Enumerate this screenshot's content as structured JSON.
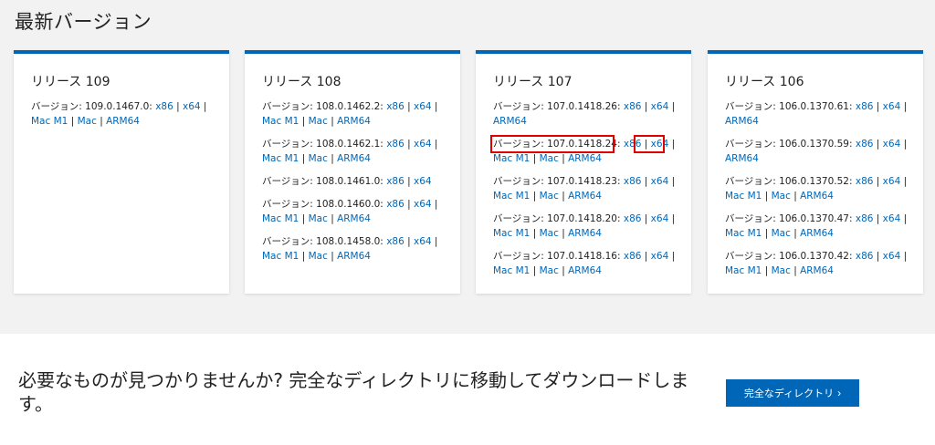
{
  "section_title": "最新バージョン",
  "cards": [
    {
      "title": "リリース 109",
      "entries": [
        {
          "label": "バージョン: 109.0.1467.0:",
          "links": [
            "x86",
            "x64",
            "Mac M1",
            "Mac",
            "ARM64"
          ]
        }
      ]
    },
    {
      "title": "リリース 108",
      "entries": [
        {
          "label": "バージョン: 108.0.1462.2:",
          "links": [
            "x86",
            "x64",
            "Mac M1",
            "Mac",
            "ARM64"
          ]
        },
        {
          "label": "バージョン: 108.0.1462.1:",
          "links": [
            "x86",
            "x64",
            "Mac M1",
            "Mac",
            "ARM64"
          ]
        },
        {
          "label": "バージョン: 108.0.1461.0:",
          "links": [
            "x86",
            "x64"
          ]
        },
        {
          "label": "バージョン: 108.0.1460.0:",
          "links": [
            "x86",
            "x64",
            "Mac M1",
            "Mac",
            "ARM64"
          ]
        },
        {
          "label": "バージョン: 108.0.1458.0:",
          "links": [
            "x86",
            "x64",
            "Mac M1",
            "Mac",
            "ARM64"
          ]
        }
      ]
    },
    {
      "title": "リリース 107",
      "entries": [
        {
          "label": "バージョン: 107.0.1418.26:",
          "links": [
            "x86",
            "x64",
            "ARM64"
          ]
        },
        {
          "label": "バージョン: 107.0.1418.24:",
          "links": [
            "x86",
            "x64",
            "Mac M1",
            "Mac",
            "ARM64"
          ]
        },
        {
          "label": "バージョン: 107.0.1418.23:",
          "links": [
            "x86",
            "x64",
            "Mac M1",
            "Mac",
            "ARM64"
          ]
        },
        {
          "label": "バージョン: 107.0.1418.20:",
          "links": [
            "x86",
            "x64",
            "Mac M1",
            "Mac",
            "ARM64"
          ]
        },
        {
          "label": "バージョン: 107.0.1418.16:",
          "links": [
            "x86",
            "x64",
            "Mac M1",
            "Mac",
            "ARM64"
          ]
        }
      ]
    },
    {
      "title": "リリース 106",
      "entries": [
        {
          "label": "バージョン: 106.0.1370.61:",
          "links": [
            "x86",
            "x64",
            "ARM64"
          ]
        },
        {
          "label": "バージョン: 106.0.1370.59:",
          "links": [
            "x86",
            "x64",
            "ARM64"
          ]
        },
        {
          "label": "バージョン: 106.0.1370.52:",
          "links": [
            "x86",
            "x64",
            "Mac M1",
            "Mac",
            "ARM64"
          ]
        },
        {
          "label": "バージョン: 106.0.1370.47:",
          "links": [
            "x86",
            "x64",
            "Mac M1",
            "Mac",
            "ARM64"
          ]
        },
        {
          "label": "バージョン: 106.0.1370.42:",
          "links": [
            "x86",
            "x64",
            "Mac M1",
            "Mac",
            "ARM64"
          ]
        }
      ]
    }
  ],
  "bottom_text": "必要なものが見つかりませんか? 完全なディレクトリに移動してダウンロードします。",
  "directory_button_label": "完全なディレクトリ",
  "button_icon": "chevron-right-icon",
  "colors": {
    "accent": "#0067b8",
    "highlight": "#e00000",
    "background": "#f2f2f2"
  }
}
